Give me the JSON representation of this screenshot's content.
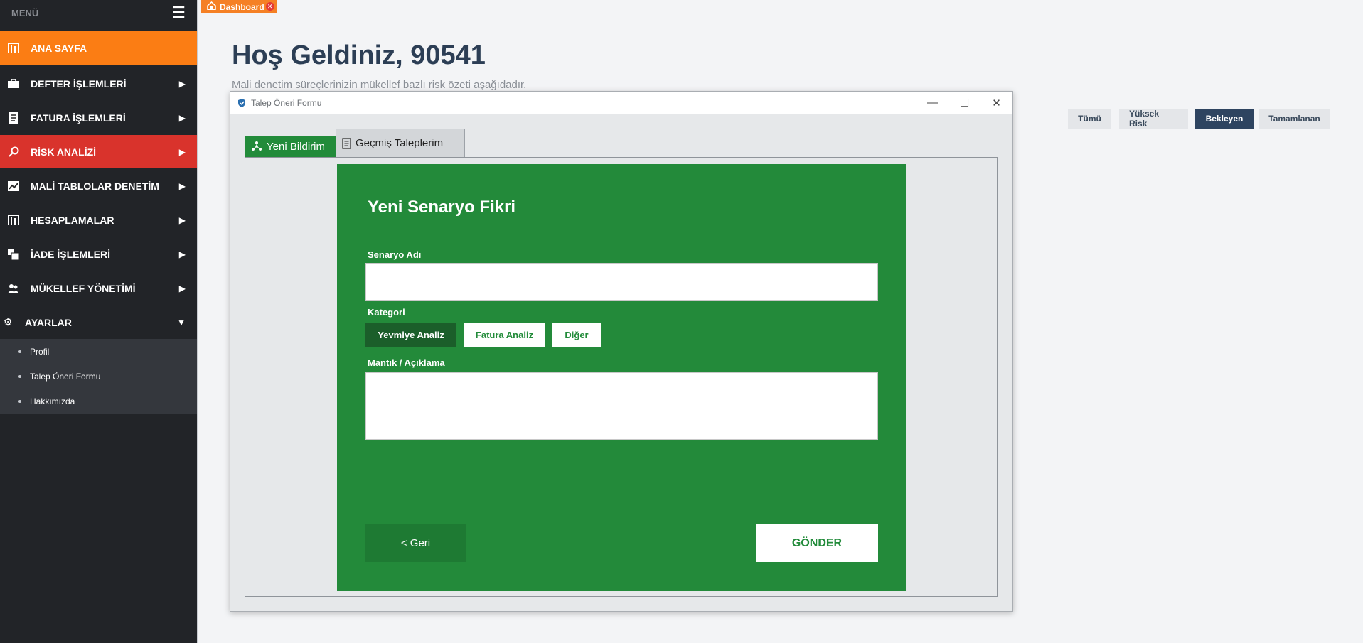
{
  "sidebar": {
    "menu_label": "MENÜ",
    "items": [
      {
        "label": "ANA SAYFA"
      },
      {
        "label": "DEFTER İŞLEMLERİ"
      },
      {
        "label": "FATURA İŞLEMLERİ"
      },
      {
        "label": "RİSK ANALİZİ"
      },
      {
        "label": "MALİ TABLOLAR DENETİM"
      },
      {
        "label": "HESAPLAMALAR"
      },
      {
        "label": "İADE İŞLEMLERİ"
      },
      {
        "label": "MÜKELLEF YÖNETİMİ"
      },
      {
        "label": "AYARLAR"
      }
    ],
    "subitems": [
      {
        "label": "Profil"
      },
      {
        "label": "Talep Öneri Formu"
      },
      {
        "label": "Hakkımızda"
      }
    ]
  },
  "tabs": {
    "dashboard": "Dashboard"
  },
  "main": {
    "welcome": "Hoş Geldiniz, 90541",
    "subtitle": "Mali denetim süreçlerinizin mükellef bazlı risk özeti aşağıdadır.",
    "filters": [
      "Tümü",
      "Yüksek Risk",
      "Bekleyen",
      "Tamamlanan"
    ],
    "active_filter": "Bekleyen"
  },
  "dialog": {
    "title": "Talep Öneri Formu",
    "tabs": [
      "Yeni Bildirim",
      "Geçmiş Taleplerim"
    ],
    "form": {
      "heading": "Yeni Senaryo Fikri",
      "name_label": "Senaryo Adı",
      "name_value": "",
      "category_label": "Kategori",
      "categories": [
        "Yevmiye Analiz",
        "Fatura Analiz",
        "Diğer"
      ],
      "selected_category": "Yevmiye Analiz",
      "logic_label": "Mantık / Açıklama",
      "logic_value": "",
      "back_label": "< Geri",
      "send_label": "GÖNDER"
    }
  },
  "colors": {
    "sidebar_bg": "#222428",
    "accent_orange": "#fb7d14",
    "accent_red": "#d9332c",
    "form_green": "#238a3a",
    "heading_navy": "#2c3e55"
  }
}
